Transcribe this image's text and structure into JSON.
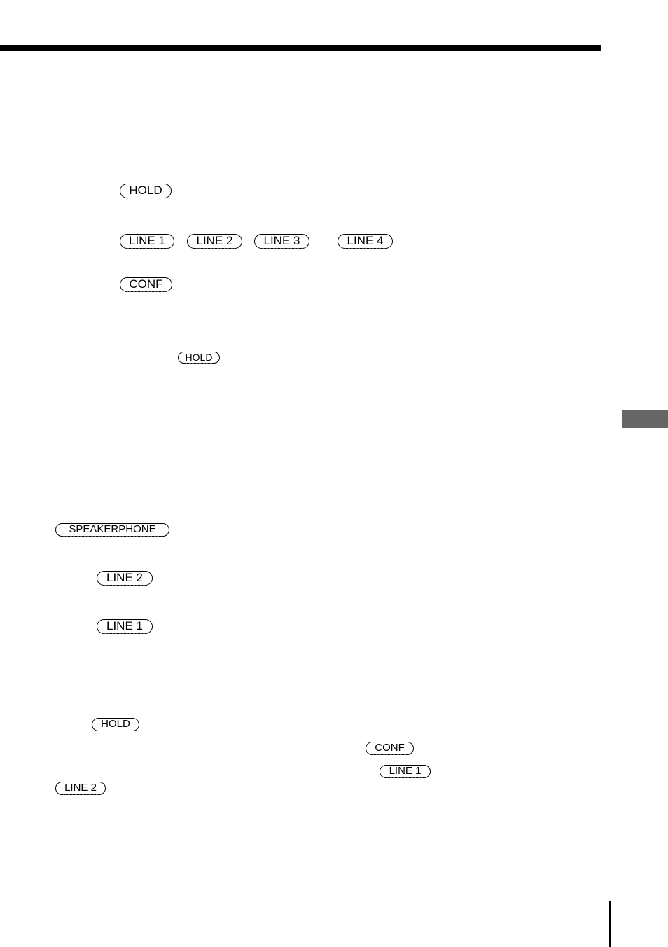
{
  "page": {
    "side_tab_color": "#666666"
  },
  "keys": {
    "hold_1": "HOLD",
    "line1_1": "LINE 1",
    "line2_1": "LINE 2",
    "line3_1": "LINE 3",
    "line4_1": "LINE 4",
    "conf_1": "CONF",
    "hold_2": "HOLD",
    "speakerphone": "SPEAKERPHONE",
    "line2_2": "LINE 2",
    "line1_2": "LINE 1",
    "hold_3": "HOLD",
    "conf_2": "CONF",
    "line1_3": "LINE 1",
    "line2_3": "LINE 2"
  }
}
